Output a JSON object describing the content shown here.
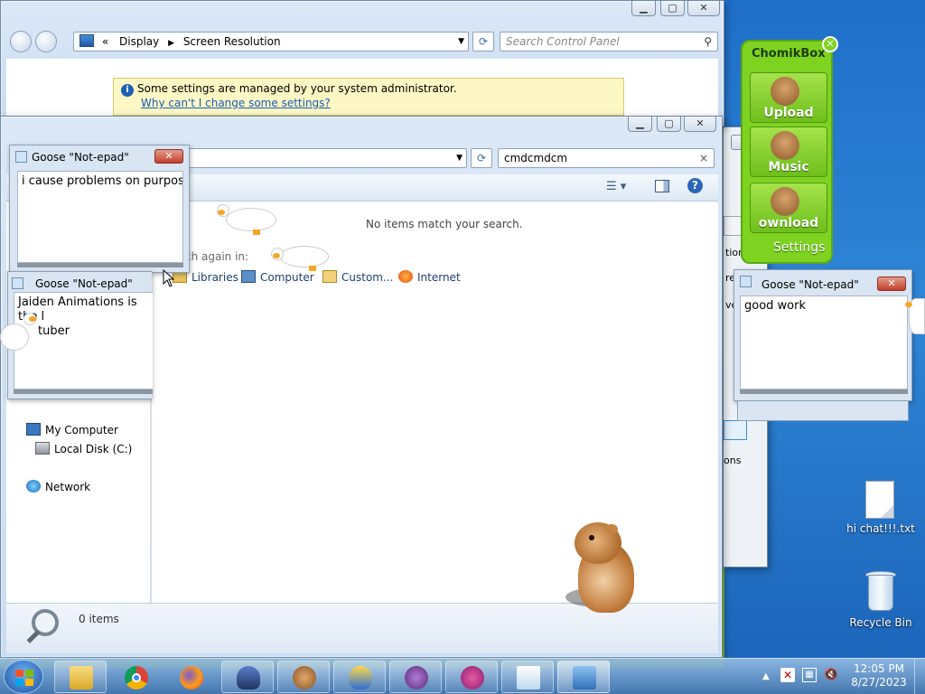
{
  "control_panel": {
    "breadcrumb_prefix": "«",
    "breadcrumb": [
      "Display",
      "Screen Resolution"
    ],
    "search_placeholder": "Search Control Panel",
    "info_text": "Some settings are managed by your system administrator.",
    "info_link": "Why can't I change some settings?"
  },
  "explorer": {
    "search_value": "cmdcmdcm",
    "no_items": "No items match your search.",
    "search_again": "ch again in:",
    "search_locations": [
      "Libraries",
      "Computer",
      "Custom...",
      "Internet"
    ],
    "nav": {
      "my_computer": "My Computer",
      "local_disk": "Local Disk (C:)",
      "network": "Network"
    },
    "status_count": "0 items"
  },
  "goose_notepads": [
    {
      "title": "Goose \"Not-epad\"",
      "text": "i cause problems on purpose"
    },
    {
      "title": "Goose \"Not-epad\"",
      "text_line1": "Jaiden Animations is the l",
      "text_line2": "tuber"
    },
    {
      "title": "Goose \"Not-epad\"",
      "text": "good work"
    }
  ],
  "background_window": {
    "partial_labels": [
      "tion",
      "re",
      "ve",
      "ons"
    ]
  },
  "chomikbox": {
    "title": "ChomikBox",
    "buttons": [
      "Upload",
      "Music",
      "ownload"
    ],
    "settings": "Settings"
  },
  "desktop": {
    "file": "hi chat!!!.txt",
    "recycle_bin": "Recycle Bin"
  },
  "taskbar": {
    "time": "12:05 PM",
    "date": "8/27/2023"
  },
  "colors": {
    "chomik_green": "#7ed321",
    "goose_close": "#c4402a",
    "info_bg": "#fcf7c4",
    "link": "#1b5bb8"
  }
}
